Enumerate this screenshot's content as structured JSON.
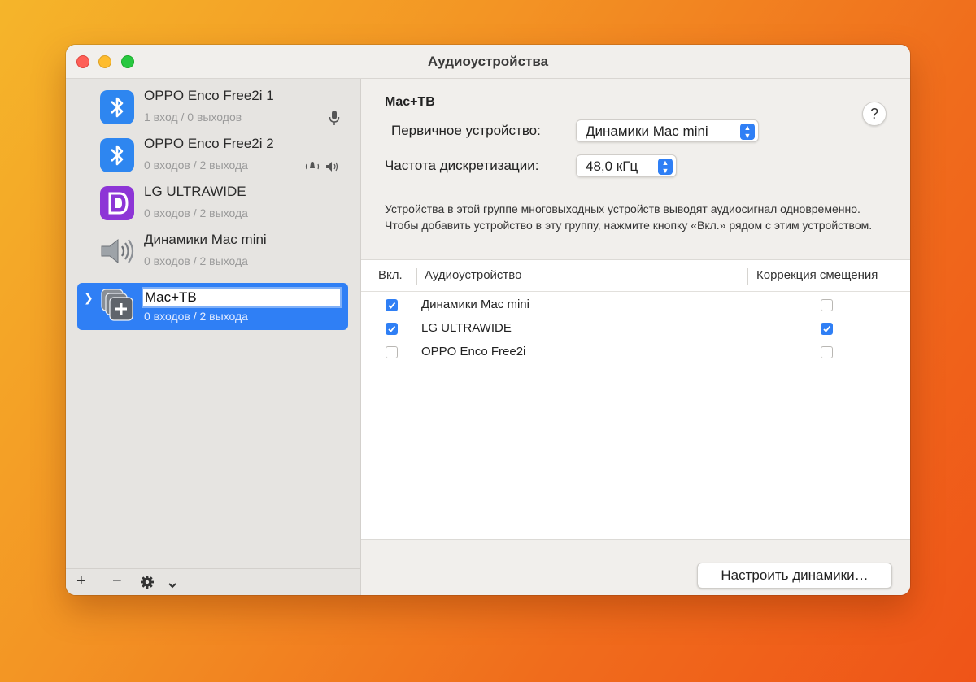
{
  "window": {
    "title": "Аудиоустройства"
  },
  "sidebar": {
    "devices": [
      {
        "name": "OPPO Enco Free2i 1",
        "io": "1 вход / 0 выходов",
        "icon": "bluetooth-icon",
        "badge": "microphone-icon"
      },
      {
        "name": "OPPO Enco Free2i 2",
        "io": "0 входов / 2 выхода",
        "icon": "bluetooth-icon",
        "badge": "speaker-icon"
      },
      {
        "name": "LG ULTRAWIDE",
        "io": "0 входов / 2 выхода",
        "icon": "displayport-icon"
      },
      {
        "name": "Динамики Mac mini",
        "io": "0 входов / 2 выхода",
        "icon": "speaker-icon"
      },
      {
        "name": "Mac+TB",
        "io": "0 входов / 2 выхода",
        "icon": "multi-output-icon",
        "selected": true,
        "editing": true
      }
    ],
    "toolbar": {
      "add": "+",
      "remove": "−",
      "settings": "gear-icon",
      "menu": "chevron-down-icon"
    }
  },
  "main": {
    "group_title": "Mac+TB",
    "help": "?",
    "primary_label": "Первичное устройство:",
    "primary_value": "Динамики Mac mini",
    "rate_label": "Частота дискретизации:",
    "rate_value": "48,0 кГц",
    "description": "Устройства в этой группе многовыходных устройств выводят аудиосигнал одновременно. Чтобы добавить устройство в эту группу, нажмите кнопку «Вкл.» рядом с этим устройством.",
    "table": {
      "headers": {
        "on": "Вкл.",
        "device": "Аудиоустройство",
        "drift": "Коррекция смещения"
      },
      "rows": [
        {
          "device": "Динамики Mac mini",
          "on": true,
          "drift": false
        },
        {
          "device": "LG ULTRAWIDE",
          "on": true,
          "drift": true
        },
        {
          "device": "OPPO Enco Free2i",
          "on": false,
          "drift": false
        }
      ]
    },
    "configure_button": "Настроить динамики…"
  },
  "colors": {
    "accent": "#2f7ff5",
    "background_gradient": [
      "#f5b52a",
      "#ef5418"
    ]
  }
}
